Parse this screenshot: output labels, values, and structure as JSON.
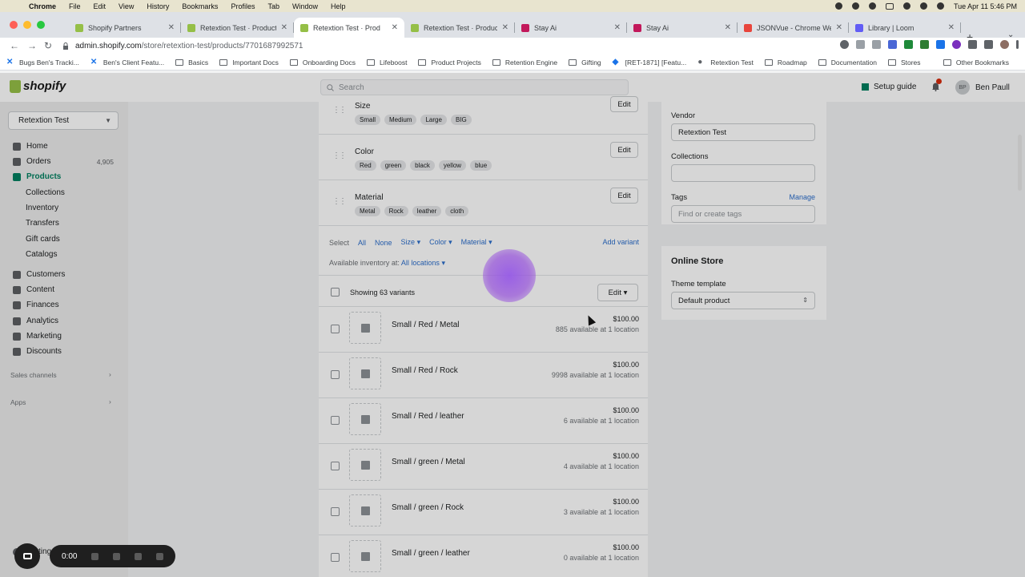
{
  "macos": {
    "menus": [
      "Chrome",
      "File",
      "Edit",
      "View",
      "History",
      "Bookmarks",
      "Profiles",
      "Tab",
      "Window",
      "Help"
    ],
    "clock": "Tue Apr 11  5:46 PM"
  },
  "browser": {
    "tabs": [
      {
        "label": "Shopify Partners",
        "color": "#95bf47"
      },
      {
        "label": "Retextion Test · Products",
        "color": "#95bf47"
      },
      {
        "label": "Retextion Test · Prod",
        "color": "#95bf47",
        "active": true
      },
      {
        "label": "Retextion Test · Products",
        "color": "#95bf47"
      },
      {
        "label": "Stay Ai",
        "color": "#c2185b"
      },
      {
        "label": "Stay Ai",
        "color": "#c2185b"
      },
      {
        "label": "JSONVue - Chrome Web",
        "color": "#e8453c"
      },
      {
        "label": "Library | Loom",
        "color": "#625df5"
      }
    ],
    "url_host": "admin.shopify.com",
    "url_path": "/store/retextion-test/products/7701687992571",
    "bookmarks": [
      {
        "label": "Bugs Ben's Tracki...",
        "icon": "x-icon"
      },
      {
        "label": "Ben's Client Featu...",
        "icon": "x-icon"
      },
      {
        "label": "Basics",
        "icon": "folder-icon"
      },
      {
        "label": "Important Docs",
        "icon": "folder-icon"
      },
      {
        "label": "Onboarding Docs",
        "icon": "folder-icon"
      },
      {
        "label": "Lifeboost",
        "icon": "folder-icon"
      },
      {
        "label": "Product Projects",
        "icon": "folder-icon"
      },
      {
        "label": "Retention Engine",
        "icon": "folder-icon"
      },
      {
        "label": "Gifting",
        "icon": "folder-icon"
      },
      {
        "label": "[RET-1871] [Featu...",
        "icon": "diamond-icon"
      },
      {
        "label": "Retextion Test",
        "icon": "globe-icon"
      },
      {
        "label": "Roadmap",
        "icon": "folder-icon"
      },
      {
        "label": "Documentation",
        "icon": "folder-icon"
      },
      {
        "label": "Stores",
        "icon": "folder-icon"
      }
    ],
    "other_bookmarks": "Other Bookmarks"
  },
  "shopify": {
    "logo": "shopify",
    "search_placeholder": "Search",
    "setup_guide": "Setup guide",
    "user_initials": "BP",
    "user_name": "Ben Paull",
    "store": "Retextion Test",
    "nav": {
      "home": "Home",
      "orders": "Orders",
      "orders_count": "4,905",
      "products": "Products",
      "collections": "Collections",
      "inventory": "Inventory",
      "transfers": "Transfers",
      "gift_cards": "Gift cards",
      "catalogs": "Catalogs",
      "customers": "Customers",
      "content": "Content",
      "finances": "Finances",
      "analytics": "Analytics",
      "marketing": "Marketing",
      "discounts": "Discounts",
      "sales_channels": "Sales channels",
      "apps": "Apps",
      "settings": "Settings"
    },
    "options": [
      {
        "name": "Size",
        "values": [
          "Small",
          "Medium",
          "Large",
          "BIG"
        ]
      },
      {
        "name": "Color",
        "values": [
          "Red",
          "green",
          "black",
          "yellow",
          "blue"
        ]
      },
      {
        "name": "Material",
        "values": [
          "Metal",
          "Rock",
          "leather",
          "cloth"
        ]
      }
    ],
    "edit_label": "Edit",
    "select_label": "Select",
    "select_filters": {
      "all": "All",
      "none": "None",
      "size": "Size",
      "color": "Color",
      "material": "Material"
    },
    "add_variant": "Add variant",
    "inventory_label": "Available inventory at:",
    "inventory_locations": "All locations",
    "showing": "Showing 63 variants",
    "variants": [
      {
        "name": "Small / Red / Metal",
        "price": "$100.00",
        "avail": "885 available at 1 location"
      },
      {
        "name": "Small / Red / Rock",
        "price": "$100.00",
        "avail": "9998 available at 1 location"
      },
      {
        "name": "Small / Red / leather",
        "price": "$100.00",
        "avail": "6 available at 1 location"
      },
      {
        "name": "Small / green / Metal",
        "price": "$100.00",
        "avail": "4 available at 1 location"
      },
      {
        "name": "Small / green / Rock",
        "price": "$100.00",
        "avail": "3 available at 1 location"
      },
      {
        "name": "Small / green / leather",
        "price": "$100.00",
        "avail": "0 available at 1 location"
      }
    ],
    "org": {
      "vendor_label": "Vendor",
      "vendor_value": "Retextion Test",
      "collections_label": "Collections",
      "tags_label": "Tags",
      "manage": "Manage",
      "tags_placeholder": "Find or create tags"
    },
    "online_store": {
      "title": "Online Store",
      "template_label": "Theme template",
      "template_value": "Default product"
    }
  },
  "loom": {
    "timer": "0:00"
  }
}
